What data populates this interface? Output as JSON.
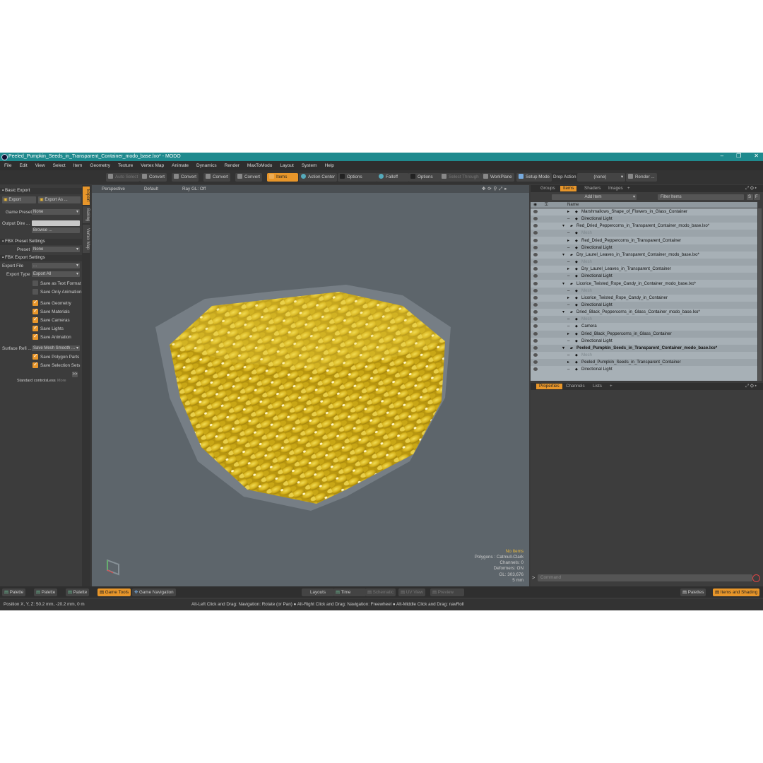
{
  "window": {
    "title": "Peeled_Pumpkin_Seeds_in_Transparent_Container_modo_base.lxo* - MODO",
    "minimize": "‒",
    "maximize": "❐",
    "close": "✕"
  },
  "menu": [
    "File",
    "Edit",
    "View",
    "Select",
    "Item",
    "Geometry",
    "Texture",
    "Vertex Map",
    "Animate",
    "Dynamics",
    "Render",
    "MaxToModo",
    "Layout",
    "System",
    "Help"
  ],
  "toolbar": {
    "auto_select": "Auto Select",
    "convert1": "Convert",
    "convert2": "Convert",
    "convert3": "Convert",
    "convert4": "Convert",
    "items": "Items",
    "action_center": "Action Center",
    "options1": "Options",
    "falloff": "Falloff",
    "options2": "Options",
    "select_through": "Select Through",
    "workplane": "WorkPlane",
    "setup_mode": "Setup Mode",
    "drop_action_label": "Drop Action",
    "drop_action_value": "(none)",
    "render": "Render ..."
  },
  "left": {
    "vtabs": [
      "Export",
      "Baking",
      "Vertex Map"
    ],
    "basic_export": "Basic Export",
    "export_btn": "Export",
    "export_as_btn": "Export As ...",
    "game_preset_label": "Game Preset",
    "game_preset_value": "None",
    "output_dir_label": "Output Dire ...",
    "browse": "Browse ...",
    "fbx_preset_settings": "FBX Preset Settings",
    "preset_label": "Preset",
    "preset_value": "None",
    "fbx_export_settings": "FBX Export Settings",
    "export_file_label": "Export File",
    "export_file_value": "...",
    "export_type_label": "Export Type",
    "export_type_value": "Export All",
    "checks": [
      {
        "label": "Save as Text Format",
        "on": false
      },
      {
        "label": "Save Only Animation",
        "on": false
      },
      {
        "label": "Save Geometry",
        "on": true
      },
      {
        "label": "Save Materials",
        "on": true
      },
      {
        "label": "Save Cameras",
        "on": true
      },
      {
        "label": "Save Lights",
        "on": true
      },
      {
        "label": "Save Animation",
        "on": true
      }
    ],
    "surface_label": "Surface Refi ...",
    "surface_value": "Save Mesh Smooth ...",
    "checks2": [
      {
        "label": "Save Polygon Parts",
        "on": true
      },
      {
        "label": "Save Selection Sets",
        "on": true
      }
    ],
    "more_arrow": ">>",
    "standard_controls": "Standard controls",
    "less": "Less",
    "more": "More"
  },
  "viewport": {
    "perspective": "Perspective",
    "default": "Default",
    "raygl": "Ray GL: Off",
    "info": [
      "No Items",
      "Polygons : Catmull-Clark",
      "Channels: 0",
      "Deformers: ON",
      "GL: 303,676",
      "5 mm"
    ]
  },
  "items_panel": {
    "tabs": [
      "Groups",
      "Items",
      "Shaders",
      "Images",
      "+"
    ],
    "add_item": "Add Item",
    "filter_items": "Filter Items",
    "name_col": "Name",
    "rows": [
      {
        "text": "Marshmallows_Shape_of_Flowers_in_Glass_Container",
        "indent": 2,
        "arrow": "▸"
      },
      {
        "text": "Directional Light",
        "indent": 2,
        "arrow": ""
      },
      {
        "text": "Red_Dried_Peppercorns_in_Transparent_Container_modo_base.lxo*",
        "indent": 1,
        "arrow": "▾"
      },
      {
        "text": "Mesh",
        "indent": 2,
        "arrow": "",
        "dim": true
      },
      {
        "text": "Red_Dried_Peppercorns_in_Transparent_Container",
        "indent": 2,
        "arrow": "▸"
      },
      {
        "text": "Directional Light",
        "indent": 2,
        "arrow": ""
      },
      {
        "text": "Dry_Laurel_Leaves_in_Transparent_Container_modo_base.lxo*",
        "indent": 1,
        "arrow": "▾"
      },
      {
        "text": "Mesh",
        "indent": 2,
        "arrow": "",
        "dim": true
      },
      {
        "text": "Dry_Laurel_Leaves_in_Transparent_Container",
        "indent": 2,
        "arrow": "▸"
      },
      {
        "text": "Directional Light",
        "indent": 2,
        "arrow": ""
      },
      {
        "text": "Licorice_Twisted_Rope_Candy_in_Container_modo_base.lxo*",
        "indent": 1,
        "arrow": "▾"
      },
      {
        "text": "Mesh",
        "indent": 2,
        "arrow": "",
        "dim": true
      },
      {
        "text": "Licorice_Twisted_Rope_Candy_in_Container",
        "indent": 2,
        "arrow": "▸"
      },
      {
        "text": "Directional Light",
        "indent": 2,
        "arrow": ""
      },
      {
        "text": "Dried_Black_Peppercorns_in_Glass_Container_modo_base.lxo*",
        "indent": 1,
        "arrow": "▾"
      },
      {
        "text": "Mesh",
        "indent": 2,
        "arrow": "",
        "dim": true
      },
      {
        "text": "Camera",
        "indent": 2,
        "arrow": ""
      },
      {
        "text": "Dried_Black_Peppercorns_in_Glass_Container",
        "indent": 2,
        "arrow": "▸"
      },
      {
        "text": "Directional Light",
        "indent": 2,
        "arrow": ""
      },
      {
        "text": "Peeled_Pumpkin_Seeds_in_Transparent_Container_modo_base.lxo*",
        "indent": 1,
        "arrow": "▾",
        "bold": true
      },
      {
        "text": "Mesh",
        "indent": 2,
        "arrow": "",
        "dim": true
      },
      {
        "text": "Peeled_Pumpkin_Seeds_in_Transparent_Container",
        "indent": 2,
        "arrow": "▸"
      },
      {
        "text": "Directional Light",
        "indent": 2,
        "arrow": ""
      }
    ]
  },
  "props_panel": {
    "tabs": [
      "Properties",
      "Channels",
      "Lists",
      "+"
    ]
  },
  "command": {
    "placeholder": "Command"
  },
  "bottom": {
    "palette1": "Palette",
    "palette2": "Palette",
    "palette3": "Palette",
    "game_tools": "Game Tools",
    "game_navigation": "Game Navigation",
    "layouts": "Layouts",
    "time": "Time",
    "schematic": "Schematic",
    "uv_view": "UV View",
    "preview": "Preview",
    "palettes": "Palettes",
    "items_and_shading": "Items and Shading"
  },
  "status": {
    "position_label": "Position X, Y, Z:",
    "position_value": "50.2 mm, -20.2 mm, 0 m",
    "hint": "Alt-Left Click and Drag: Navigation: Rotate (or Pan) ● Alt-Right Click and Drag: Navigation: Freewheel ● Alt-Middle Click and Drag: navRoll"
  },
  "colors": {
    "accent": "#e8962a",
    "titlebar": "#1f8a8e",
    "seed": "#d8b41c"
  }
}
